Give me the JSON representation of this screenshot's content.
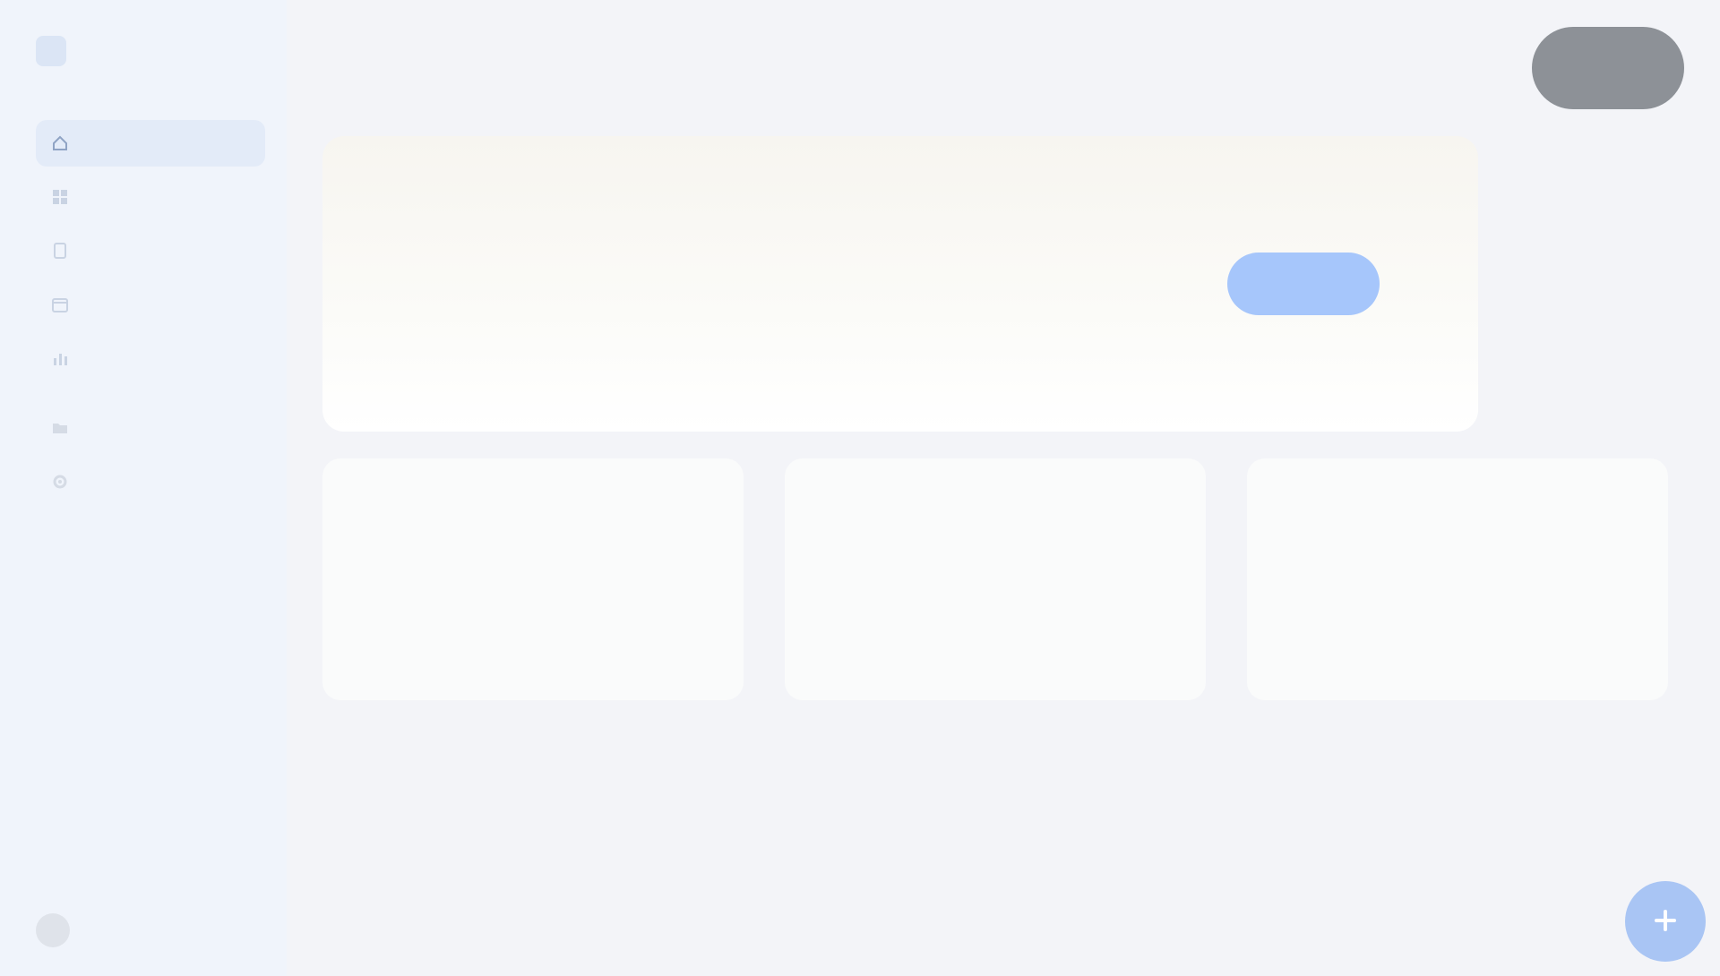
{
  "colors": {
    "background": "#f3f4f8",
    "sidebar": "#f0f4fb",
    "accent": "#a6c6fb",
    "profile": "#8d9197",
    "fab": "#a9c5f4"
  },
  "sidebar": {
    "brand": "",
    "items": [
      {
        "label": "",
        "icon": "home-icon"
      },
      {
        "label": "",
        "icon": "grid-icon"
      },
      {
        "label": "",
        "icon": "document-icon"
      },
      {
        "label": "",
        "icon": "calendar-icon"
      },
      {
        "label": "",
        "icon": "chart-icon"
      }
    ],
    "section_label": "",
    "secondary_items": [
      {
        "label": "",
        "icon": "folder-icon"
      },
      {
        "label": "",
        "icon": "settings-icon"
      }
    ],
    "footer_label": ""
  },
  "header": {
    "title": "",
    "profile_label": ""
  },
  "hero": {
    "eyebrow": "",
    "heading": "",
    "subtitle": "",
    "side_note": "",
    "cta_label": ""
  },
  "cards": [
    {
      "title": "",
      "description": "",
      "link": ""
    },
    {
      "title": "",
      "description": "",
      "link": ""
    },
    {
      "title": "",
      "description": "",
      "link": ""
    }
  ],
  "fab": {
    "icon": "plus-icon"
  }
}
